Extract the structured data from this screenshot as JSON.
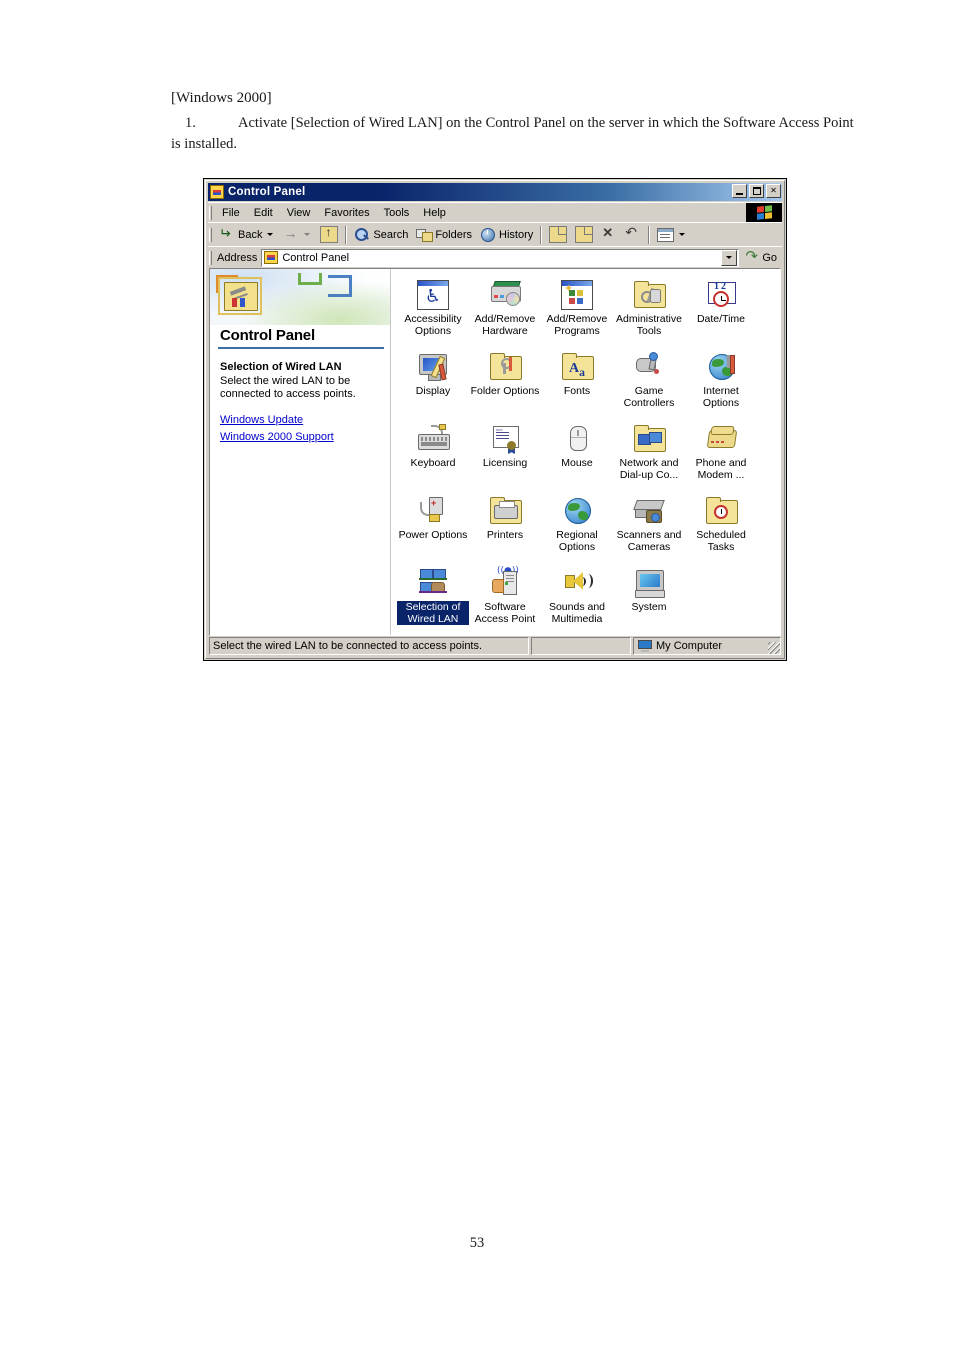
{
  "document": {
    "heading": "[Windows 2000]",
    "step_number": "1.",
    "step_text": "Activate [Selection of Wired LAN] on the Control Panel on the server in which the Software Access Point is installed.",
    "page_number": "53"
  },
  "window": {
    "title": "Control Panel",
    "buttons": {
      "minimize": "_",
      "maximize": "□",
      "close": "✕"
    },
    "menu": [
      {
        "label": "File"
      },
      {
        "label": "Edit"
      },
      {
        "label": "View"
      },
      {
        "label": "Favorites"
      },
      {
        "label": "Tools"
      },
      {
        "label": "Help"
      }
    ],
    "toolbar": [
      {
        "label": "Back",
        "icon": "back-arrow-icon"
      },
      {
        "label": "",
        "icon": "forward-arrow-icon"
      },
      {
        "label": "",
        "icon": "up-folder-icon"
      },
      {
        "label": "Search",
        "icon": "search-icon"
      },
      {
        "label": "Folders",
        "icon": "folders-icon"
      },
      {
        "label": "History",
        "icon": "history-icon"
      },
      {
        "label": "",
        "icon": "move-to-icon"
      },
      {
        "label": "",
        "icon": "copy-to-icon"
      },
      {
        "label": "",
        "icon": "delete-icon"
      },
      {
        "label": "",
        "icon": "undo-icon"
      },
      {
        "label": "",
        "icon": "views-icon"
      }
    ],
    "address": {
      "label": "Address",
      "value": "Control Panel",
      "go_label": "Go"
    },
    "left_pane": {
      "title": "Control Panel",
      "selected_item_title": "Selection of Wired LAN",
      "selected_item_desc": "Select the wired LAN to be connected to access points.",
      "links": [
        {
          "label": "Windows Update"
        },
        {
          "label": "Windows 2000 Support"
        }
      ]
    },
    "items": [
      {
        "label": "Accessibility Options",
        "icon": "accessibility-options-icon",
        "selected": false
      },
      {
        "label": "Add/Remove Hardware",
        "icon": "add-remove-hardware-icon",
        "selected": false
      },
      {
        "label": "Add/Remove Programs",
        "icon": "add-remove-programs-icon",
        "selected": false
      },
      {
        "label": "Administrative Tools",
        "icon": "administrative-tools-icon",
        "selected": false
      },
      {
        "label": "Date/Time",
        "icon": "date-time-icon",
        "selected": false
      },
      {
        "label": "Display",
        "icon": "display-icon",
        "selected": false
      },
      {
        "label": "Folder Options",
        "icon": "folder-options-icon",
        "selected": false
      },
      {
        "label": "Fonts",
        "icon": "fonts-icon",
        "selected": false
      },
      {
        "label": "Game Controllers",
        "icon": "game-controllers-icon",
        "selected": false
      },
      {
        "label": "Internet Options",
        "icon": "internet-options-icon",
        "selected": false
      },
      {
        "label": "Keyboard",
        "icon": "keyboard-icon",
        "selected": false
      },
      {
        "label": "Licensing",
        "icon": "licensing-icon",
        "selected": false
      },
      {
        "label": "Mouse",
        "icon": "mouse-icon",
        "selected": false
      },
      {
        "label": "Network and Dial-up Co...",
        "icon": "network-dialup-icon",
        "selected": false
      },
      {
        "label": "Phone and Modem ...",
        "icon": "phone-modem-icon",
        "selected": false
      },
      {
        "label": "Power Options",
        "icon": "power-options-icon",
        "selected": false
      },
      {
        "label": "Printers",
        "icon": "printers-icon",
        "selected": false
      },
      {
        "label": "Regional Options",
        "icon": "regional-options-icon",
        "selected": false
      },
      {
        "label": "Scanners and Cameras",
        "icon": "scanners-cameras-icon",
        "selected": false
      },
      {
        "label": "Scheduled Tasks",
        "icon": "scheduled-tasks-icon",
        "selected": false
      },
      {
        "label": "Selection of Wired LAN",
        "icon": "selection-of-wired-lan-icon",
        "selected": true
      },
      {
        "label": "Software Access Point",
        "icon": "software-access-point-icon",
        "selected": false
      },
      {
        "label": "Sounds and Multimedia",
        "icon": "sounds-multimedia-icon",
        "selected": false
      },
      {
        "label": "System",
        "icon": "system-icon",
        "selected": false
      }
    ],
    "statusbar": {
      "message": "Select the wired LAN to be connected to access points.",
      "middle": "",
      "zone": "My Computer"
    }
  },
  "colors": {
    "titlebar_start": "#0a246a",
    "titlebar_end": "#a6caf0",
    "selection": "#0a246a",
    "link": "#0000cc",
    "window_face": "#d4d0c8",
    "accent_rule": "#3a6ea5"
  }
}
